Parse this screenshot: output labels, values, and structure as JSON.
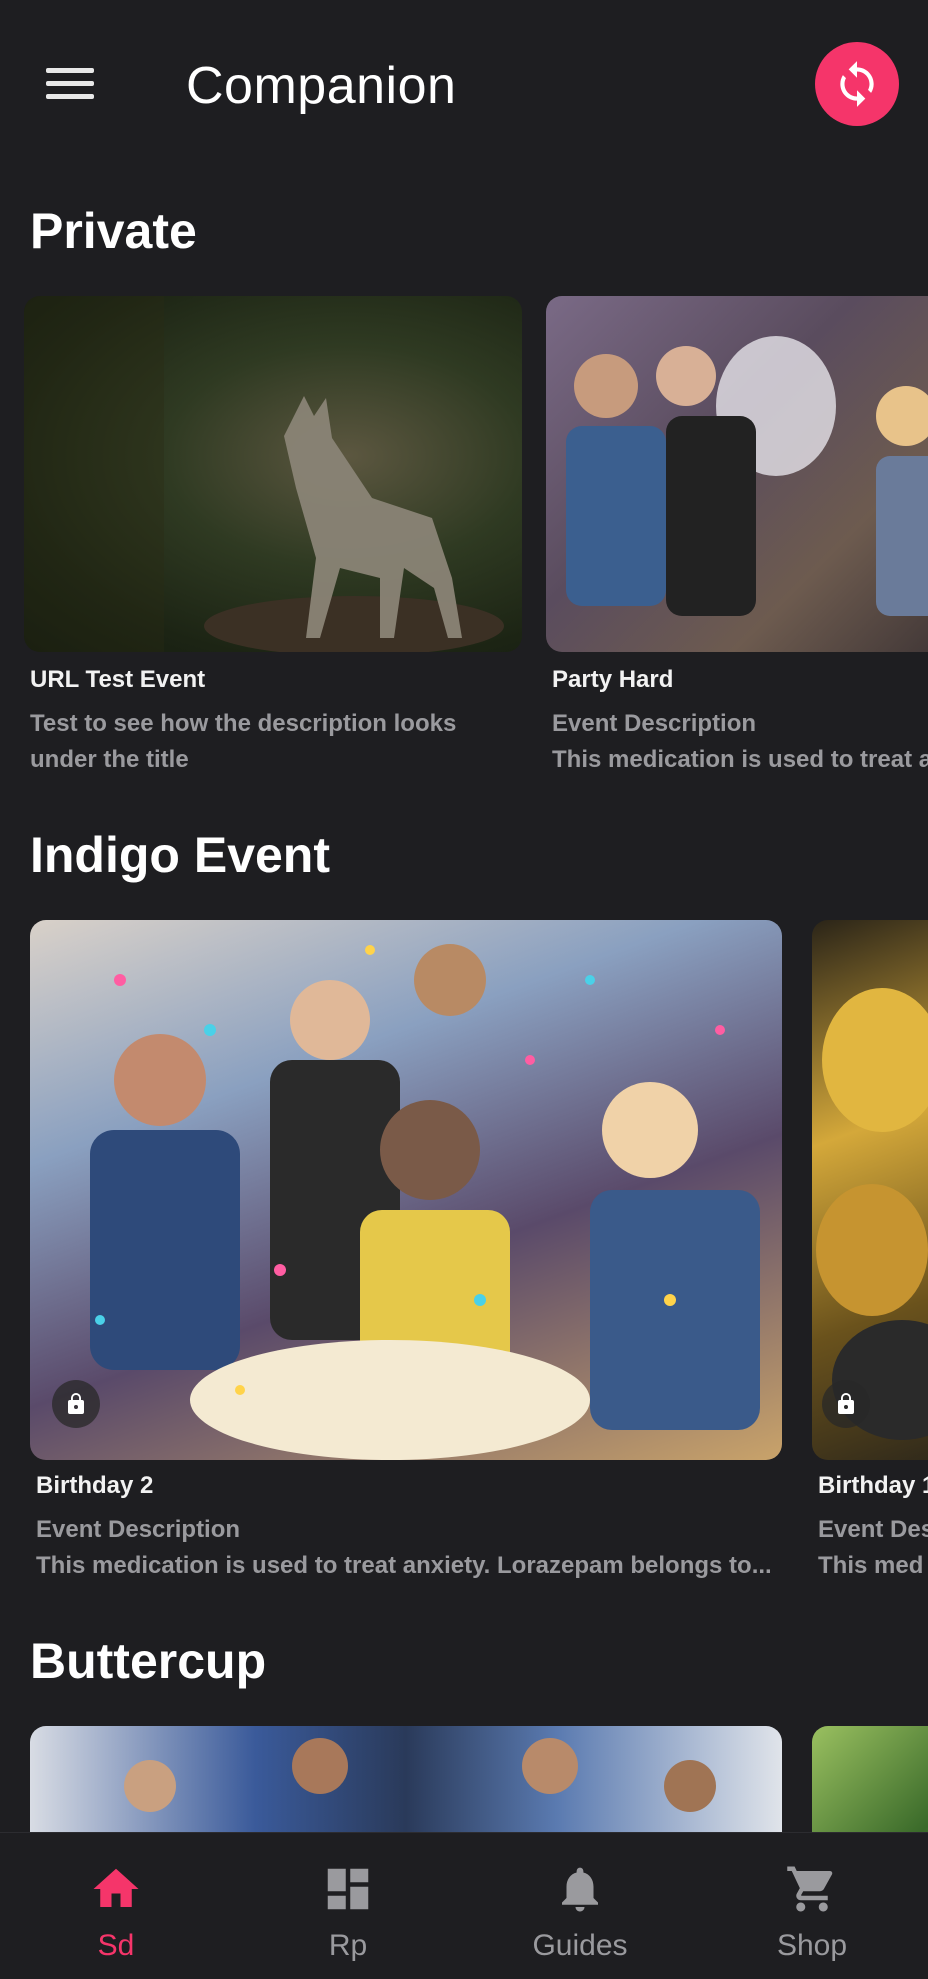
{
  "header": {
    "title": "Companion",
    "menu_icon": "hamburger-menu-icon",
    "sync_icon": "sync-icon",
    "accent": "#f5356a"
  },
  "sections": [
    {
      "title": "Private",
      "cards": [
        {
          "title": "URL Test Event",
          "desc_line1": "Test to see how the description looks",
          "desc_line2": "under the title",
          "image": "wolf-photo"
        },
        {
          "title": "Party Hard",
          "desc_line1": "Event Description",
          "desc_line2": "This medication is used to treat a",
          "image": "party-photo"
        }
      ]
    },
    {
      "title": "Indigo Event",
      "cards": [
        {
          "title": "Birthday 2",
          "desc_line1": "Event Description",
          "desc_line2": "This medication is used to treat anxiety. Lorazepam belongs to...",
          "image": "birthday-photo",
          "locked": true
        },
        {
          "title": "Birthday 1",
          "desc_line1": "Event Des",
          "desc_line2": "This med",
          "image": "balloons-photo",
          "locked": true
        }
      ]
    },
    {
      "title": "Buttercup",
      "cards": [
        {
          "image": "group-photo"
        },
        {
          "image": "garden-photo"
        }
      ]
    }
  ],
  "bottom_nav": {
    "items": [
      {
        "label": "Sd",
        "icon": "home-icon",
        "active": true
      },
      {
        "label": "Rp",
        "icon": "dashboard-icon",
        "active": false
      },
      {
        "label": "Guides",
        "icon": "bell-icon",
        "active": false
      },
      {
        "label": "Shop",
        "icon": "cart-icon",
        "active": false
      }
    ]
  },
  "colors": {
    "background": "#1e1e21",
    "accent": "#f5356a",
    "muted_text": "#9a9a9e"
  }
}
